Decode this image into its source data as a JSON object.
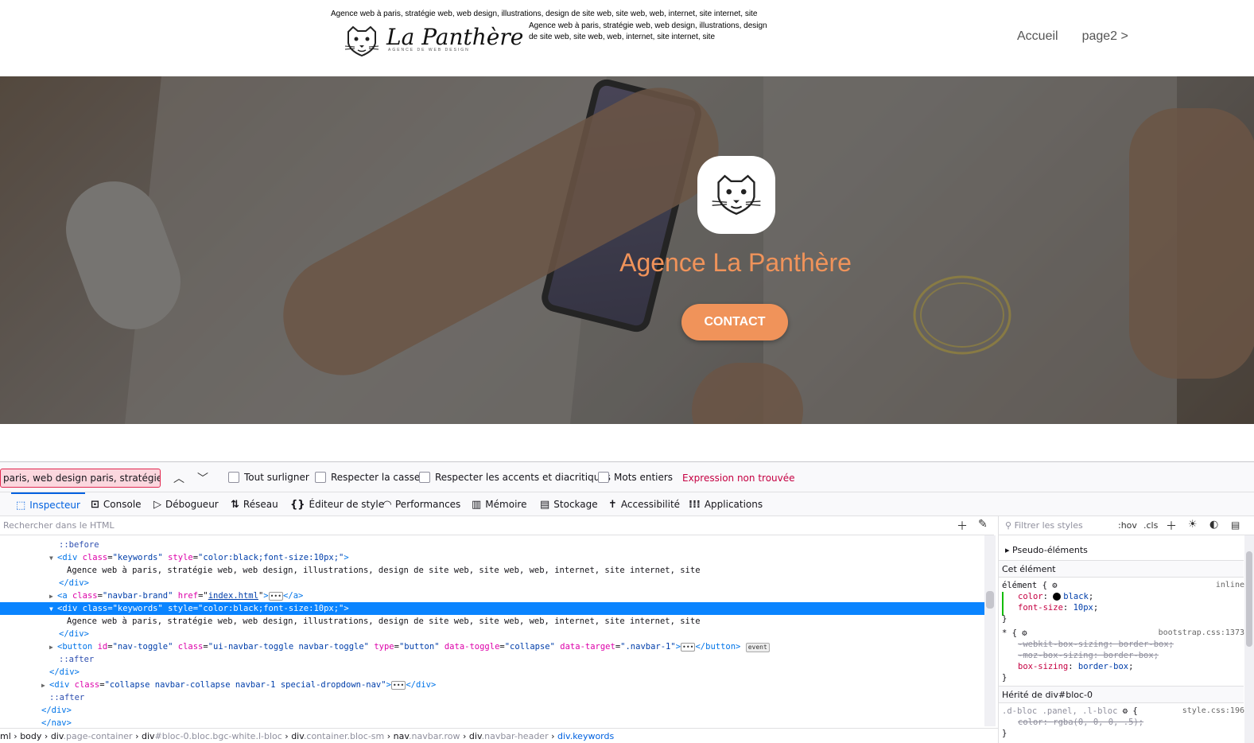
{
  "site": {
    "keywords_top": "Agence web à paris, stratégie web, web design, illustrations, design de site web, site web, web, internet, site internet, site",
    "brand_name": "La Panthère",
    "brand_subtitle": "AGENCE DE WEB DESIGN",
    "keywords_side": "Agence web à paris, stratégie web, web design, illustrations, design de site web, site web, web, internet, site internet, site",
    "nav": {
      "home": "Accueil",
      "page2": "page2 >"
    },
    "hero_title": "Agence La Panthère",
    "contact_label": "CONTACT",
    "accent_color": "#f0935a"
  },
  "findbar": {
    "query": "paris, web design paris, stratégie web",
    "highlight_all": "Tout surligner",
    "match_case": "Respecter la casse",
    "match_diacritics": "Respecter les accents et diacritiques",
    "whole_words": "Mots entiers",
    "status": "Expression non trouvée"
  },
  "devtools_tabs": [
    {
      "label": "Inspecteur",
      "icon": "inspector-icon"
    },
    {
      "label": "Console",
      "icon": "console-icon"
    },
    {
      "label": "Débogueur",
      "icon": "debugger-icon"
    },
    {
      "label": "Réseau",
      "icon": "network-icon"
    },
    {
      "label": "Éditeur de style",
      "icon": "style-editor-icon"
    },
    {
      "label": "Performances",
      "icon": "performance-icon"
    },
    {
      "label": "Mémoire",
      "icon": "memory-icon"
    },
    {
      "label": "Stockage",
      "icon": "storage-icon"
    },
    {
      "label": "Accessibilité",
      "icon": "accessibility-icon"
    },
    {
      "label": "Applications",
      "icon": "applications-icon"
    }
  ],
  "inspector": {
    "search_placeholder": "Rechercher dans le HTML",
    "tree": {
      "before": "::before",
      "div_kw_open": "div",
      "attr_class": "class",
      "val_keywords": "\"keywords\"",
      "attr_style": "style",
      "val_style": "\"color:black;font-size:10px;\"",
      "kw_text": "Agence web à paris, stratégie web, web design, illustrations, design de site web, site web, web, internet, site internet, site",
      "div_close": "</div>",
      "a_tag": "a",
      "val_navbar_brand": "\"navbar-brand\"",
      "attr_href": "href",
      "val_href": "index.html",
      "a_close": "</a>",
      "button_tag": "button",
      "attr_id": "id",
      "val_nav_toggle": "\"nav-toggle\"",
      "val_btn_class": "\"ui-navbar-toggle navbar-toggle\"",
      "attr_type": "type",
      "val_type": "\"button\"",
      "attr_data_toggle": "data-toggle",
      "val_collapse": "\"collapse\"",
      "attr_data_target": "data-target",
      "val_target": "\".navbar-1\"",
      "button_close": "</button>",
      "event_badge": "event",
      "after": "::after",
      "collapse_class": "\"collapse navbar-collapse navbar-1 special-dropdown-nav\"",
      "nav_close": "</nav>"
    },
    "breadcrumbs": [
      {
        "tag": "ml",
        "cls": ""
      },
      {
        "tag": "body",
        "cls": ""
      },
      {
        "tag": "div",
        "cls": ".page-container"
      },
      {
        "tag": "div",
        "cls": "#bloc-0.bloc.bgc-white.l-bloc"
      },
      {
        "tag": "div",
        "cls": ".container.bloc-sm"
      },
      {
        "tag": "nav",
        "cls": ".navbar.row"
      },
      {
        "tag": "div",
        "cls": ".navbar-header"
      },
      {
        "tag": "div",
        "cls": ".keywords"
      }
    ]
  },
  "rules": {
    "filter_placeholder": "Filtrer les styles",
    "hov": ":hov",
    "cls": ".cls",
    "pseudo": "Pseudo-éléments",
    "this_element": "Cet élément",
    "element_sel": "élément {",
    "inline": "inline",
    "color_prop": "color",
    "color_val": "black",
    "fontsize_prop": "font-size",
    "fontsize_val": "10px",
    "close_brace": "}",
    "star_sel": "* {",
    "bootstrap_src": "bootstrap.css:1373",
    "webkit_prop": "-webkit-box-sizing",
    "moz_prop": "-moz-box-sizing",
    "box_prop": "box-sizing",
    "border_box": "border-box",
    "inherited": "Hérité de div#bloc-0",
    "bloc_sel": ".d-bloc .panel, .l-bloc",
    "open_brace": "{",
    "style_src": "style.css:196",
    "rgba_val": "rgba(0, 0, 0, .5)"
  }
}
